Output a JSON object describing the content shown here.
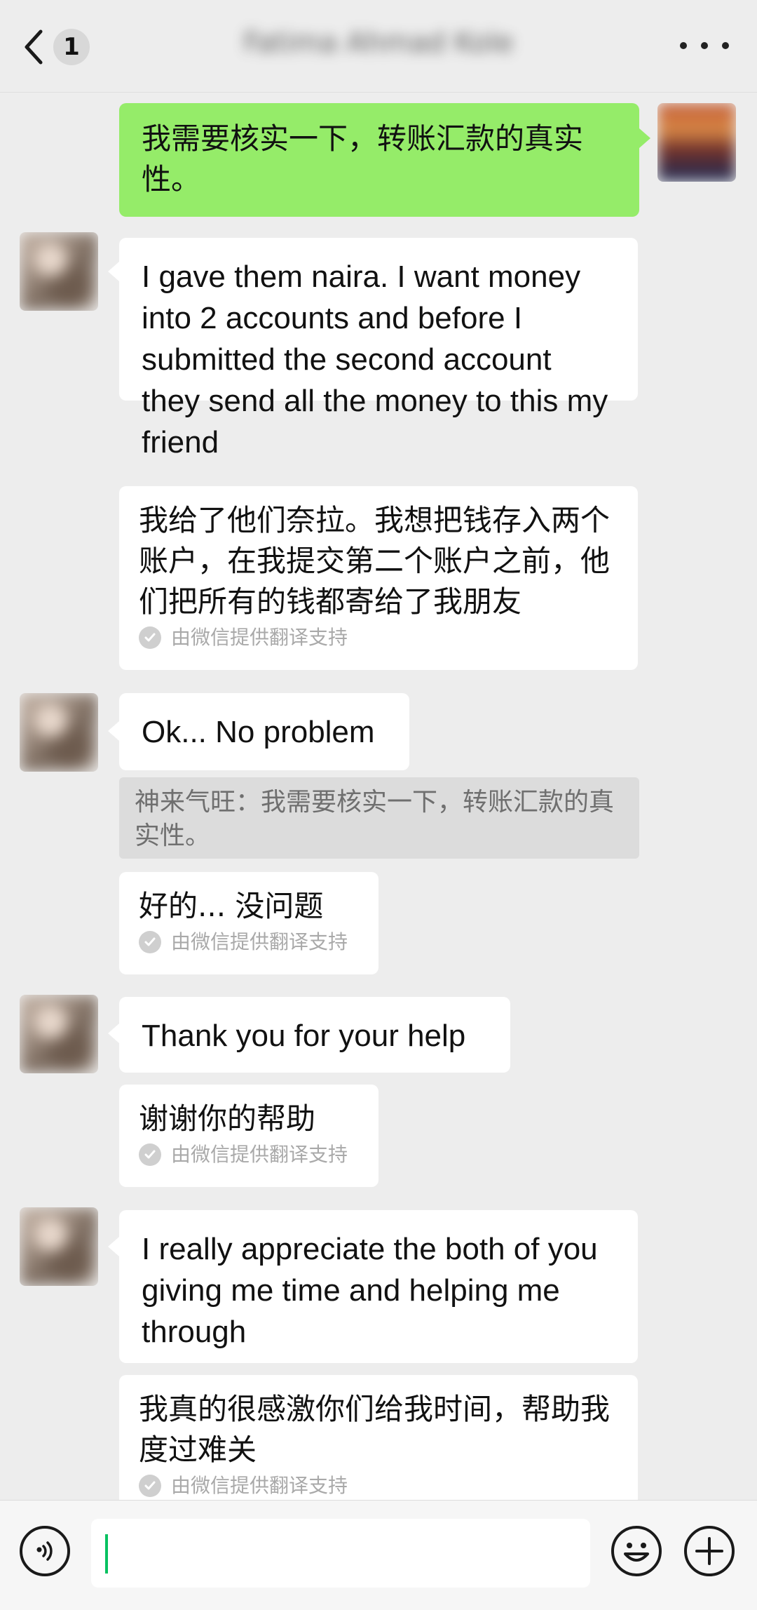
{
  "header": {
    "unread_count": "1",
    "title": "Fatima Ahmad Kole"
  },
  "messages": {
    "own_1": "我需要核实一下，转账汇款的真实性。",
    "m1_en": "I gave them naira. I want money into 2 accounts and before I submitted the second account they send all the money to this my friend",
    "m1_cn": "我给了他们奈拉。我想把钱存入两个账户，在我提交第二个账户之前，他们把所有的钱都寄给了我朋友",
    "m2_en": "Ok... No problem",
    "m2_quote": "神来气旺：我需要核实一下，转账汇款的真实性。",
    "m2_cn": "好的... 没问题",
    "m3_en": "Thank you for your help",
    "m3_cn": "谢谢你的帮助",
    "m4_en": "I really appreciate the both of you giving me time and helping me through",
    "m4_cn": "我真的很感激你们给我时间，帮助我度过难关",
    "translate_note": "由微信提供翻译支持"
  },
  "icons": {
    "back": "chevron-left-icon",
    "more": "more-dots-icon",
    "voice": "voice-icon",
    "emoji": "emoji-icon",
    "plus": "plus-icon",
    "check": "check-icon"
  },
  "colors": {
    "own_bubble": "#95ec69",
    "peer_bubble": "#ffffff",
    "background": "#ededed",
    "caret": "#07c160"
  }
}
